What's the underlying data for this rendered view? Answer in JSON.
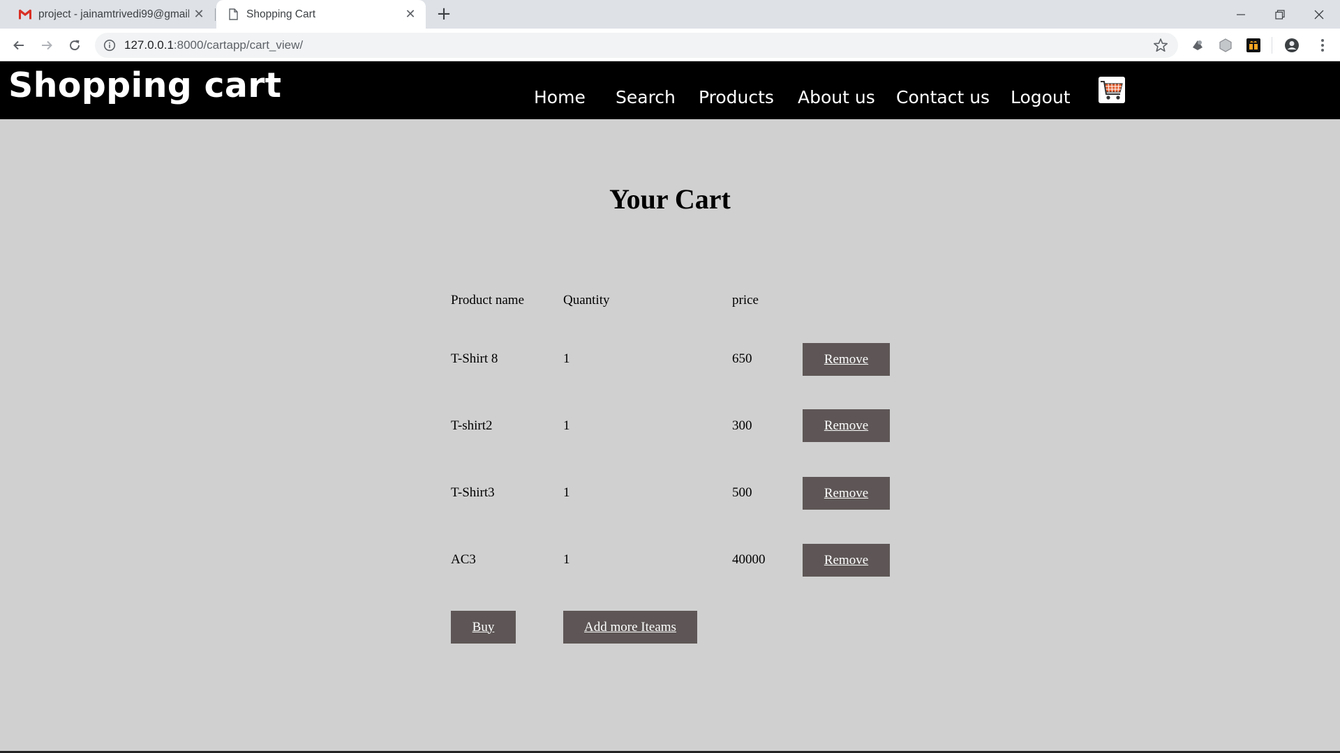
{
  "browser": {
    "tabs": [
      {
        "title": "project - jainamtrivedi99@gmail.com",
        "favicon": "gmail-icon",
        "active": false
      },
      {
        "title": "Shopping Cart",
        "favicon": "page-icon",
        "active": true
      }
    ],
    "url_host": "127.0.0.1",
    "url_rest": ":8000/cartapp/cart_view/"
  },
  "site": {
    "brand": "Shopping cart",
    "nav": [
      "Home",
      "Search",
      "Products",
      "About us",
      "Contact us",
      "Logout"
    ],
    "cart_icon": "shopping-cart-icon"
  },
  "cart": {
    "title": "Your Cart",
    "headers": {
      "name": "Product name",
      "quantity": "Quantity",
      "price": "price"
    },
    "items": [
      {
        "name": "T-Shirt 8",
        "quantity": "1",
        "price": "650",
        "action": "Remove"
      },
      {
        "name": "T-shirt2",
        "quantity": "1",
        "price": "300",
        "action": "Remove"
      },
      {
        "name": "T-Shirt3",
        "quantity": "1",
        "price": "500",
        "action": "Remove"
      },
      {
        "name": "AC3",
        "quantity": "1",
        "price": "40000",
        "action": "Remove"
      }
    ],
    "buy_label": "Buy",
    "add_more_label": "Add more Iteams"
  },
  "colors": {
    "header_bg": "#000000",
    "page_bg": "#d0d0d0",
    "button_bg": "#5e5656"
  }
}
